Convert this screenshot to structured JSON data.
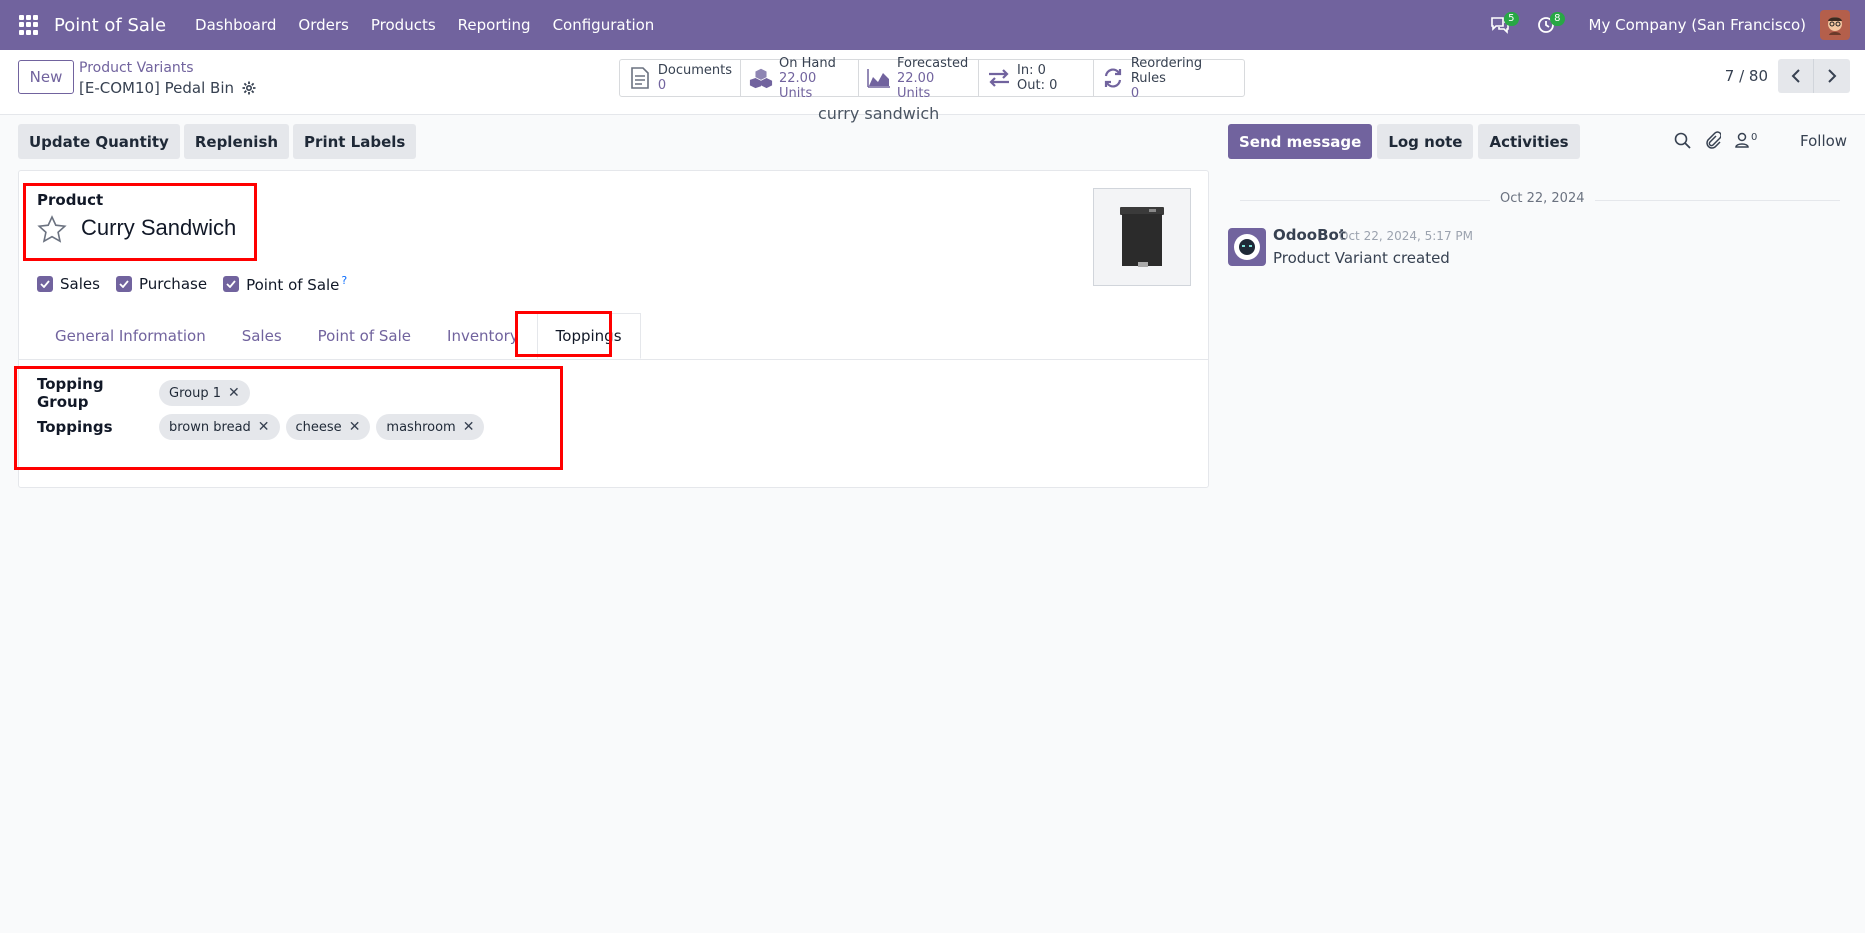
{
  "navbar": {
    "app_name": "Point of Sale",
    "menu": [
      "Dashboard",
      "Orders",
      "Products",
      "Reporting",
      "Configuration"
    ],
    "messages_count": "5",
    "activities_count": "8",
    "company": "My Company (San Francisco)"
  },
  "control": {
    "new_label": "New",
    "breadcrumb": "Product Variants",
    "record_name": "[E-COM10] Pedal Bin",
    "pager": "7 / 80"
  },
  "smart_buttons": {
    "documents": {
      "label": "Documents",
      "value": "0"
    },
    "on_hand": {
      "label": "On Hand",
      "value": "22.00 Units"
    },
    "forecasted": {
      "label": "Forecasted",
      "value": "22.00 Units"
    },
    "in_out": {
      "in": "In: 0",
      "out": "Out: 0"
    },
    "reordering": {
      "label": "Reordering Rules",
      "value": "0"
    }
  },
  "caption": "curry sandwich",
  "actions": {
    "update_quantity": "Update Quantity",
    "replenish": "Replenish",
    "print_labels": "Print Labels"
  },
  "form": {
    "product_label": "Product",
    "product_name": "Curry Sandwich",
    "checkboxes": {
      "sales": "Sales",
      "purchase": "Purchase",
      "pos": "Point of Sale",
      "help": "?"
    },
    "tabs": [
      "General Information",
      "Sales",
      "Point of Sale",
      "Inventory",
      "Toppings"
    ],
    "active_tab": "Toppings",
    "topping_group_label": "Topping Group",
    "topping_group_tags": [
      "Group 1"
    ],
    "toppings_label": "Toppings",
    "toppings_tags": [
      "brown bread",
      "cheese",
      "mashroom"
    ]
  },
  "chatter": {
    "send_message": "Send message",
    "log_note": "Log note",
    "activities": "Activities",
    "followers_count": "0",
    "follow": "Follow",
    "date_separator": "Oct 22, 2024",
    "message": {
      "author": "OdooBot",
      "date": "Oct 22, 2024, 5:17 PM",
      "body": "Product Variant created"
    }
  },
  "colors": {
    "brand": "#71639e",
    "highlight": "#ff0000",
    "badge": "#28a745"
  }
}
